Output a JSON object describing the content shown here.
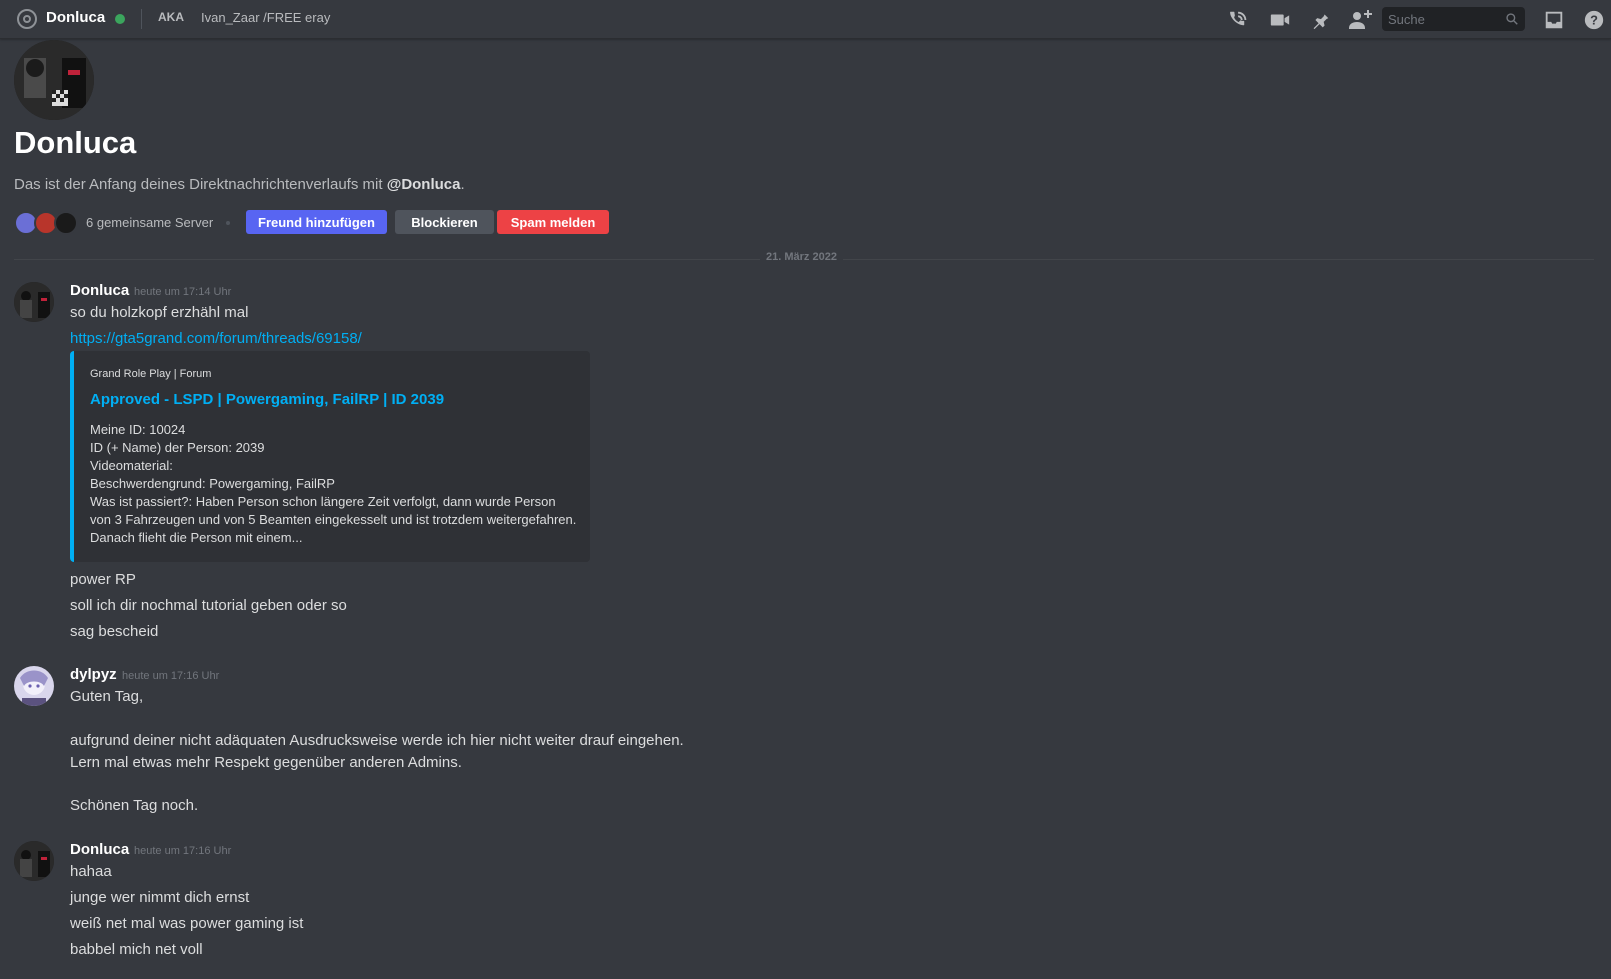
{
  "topbar": {
    "name": "Donluca",
    "aka_label": "AKA",
    "aka_names": "Ivan_Zaar /FREE eray",
    "search_placeholder": "Suche",
    "icons": [
      "at-icon",
      "voice-call-icon",
      "video-call-icon",
      "pin-icon",
      "add-friend-icon",
      "search-icon",
      "inbox-icon",
      "help-icon"
    ]
  },
  "header": {
    "name": "Donluca",
    "description_prefix": "Das ist der Anfang deines Direktnachrichtenverlaufs mit ",
    "description_mention": "@Donluca",
    "description_suffix": ".",
    "mutual_servers": "6 gemeinsame Server",
    "add_friend_label": "Freund hinzufügen",
    "block_label": "Blockieren",
    "spam_label": "Spam melden"
  },
  "date_separator": "21. März 2022",
  "messages": [
    {
      "author": "Donluca",
      "time": "heute um 17:14 Uhr",
      "line1": "so du holzkopf erzhähl mal",
      "link": "https://gta5grand.com/forum/threads/69158/",
      "embed": {
        "provider": "Grand Role Play | Forum",
        "title": "Approved - LSPD | Powergaming, FailRP | ID 2039",
        "lines": [
          "Meine ID: 10024",
          "ID (+ Name) der Person: 2039",
          "Videomaterial:",
          "Beschwerdengrund: Powergaming, FailRP",
          "Was ist passiert?: Haben Person schon längere Zeit verfolgt, dann wurde Person",
          "von 3 Fahrzeugen und von 5 Beamten eingekesselt und ist trotzdem weitergefahren.",
          "Danach flieht die Person mit einem..."
        ]
      },
      "followups": [
        "power RP",
        "soll ich dir nochmal tutorial geben oder so",
        "sag bescheid"
      ]
    },
    {
      "author": "dylpyz",
      "time": "heute um 17:16 Uhr",
      "lines": [
        "Guten Tag,",
        "aufgrund deiner nicht adäquaten Ausdrucksweise werde ich hier nicht weiter drauf eingehen.",
        "Lern mal etwas mehr Respekt gegenüber anderen Admins.",
        "Schönen Tag noch."
      ]
    },
    {
      "author": "Donluca",
      "time": "heute um 17:16 Uhr",
      "lines": [
        "hahaa",
        "junge wer nimmt dich ernst",
        "weiß net mal was power gaming ist",
        "babbel mich net voll"
      ]
    }
  ],
  "colors": {
    "background": "#36393f",
    "accent_blurple": "#5865f2",
    "danger_red": "#ed4245",
    "link_blue": "#00aff4",
    "online_green": "#3ba55d"
  }
}
